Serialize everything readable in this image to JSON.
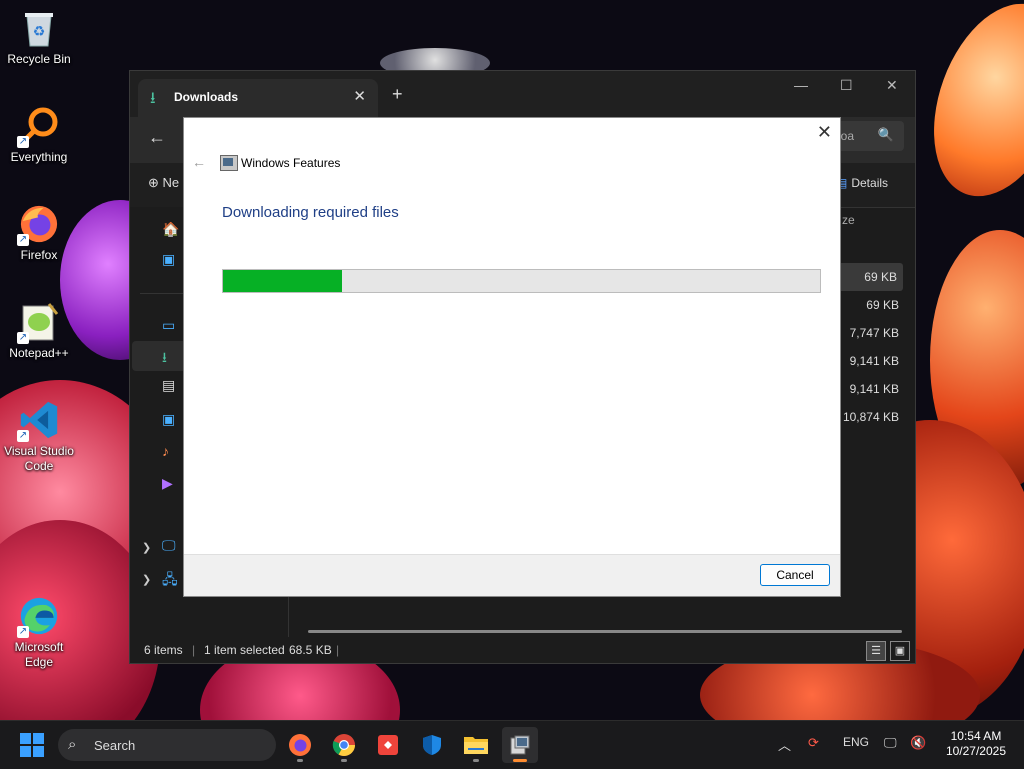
{
  "desktop": {
    "icons": [
      {
        "label": "Recycle Bin",
        "icon": "recycle-bin-icon"
      },
      {
        "label": "Everything",
        "icon": "everything-icon"
      },
      {
        "label": "Firefox",
        "icon": "firefox-icon"
      },
      {
        "label": "Notepad++",
        "icon": "notepad-plus-plus-icon"
      },
      {
        "label": "Visual Studio Code",
        "icon": "vscode-icon"
      },
      {
        "label": "Microsoft Edge",
        "icon": "edge-icon"
      }
    ]
  },
  "explorer": {
    "tab_title": "Downloads",
    "search_text": "loa",
    "new_label": "Ne",
    "details_label": "Details",
    "size_column": "ze",
    "sizes": [
      "69 KB",
      "69 KB",
      "7,747 KB",
      "9,141 KB",
      "9,141 KB",
      "10,874 KB"
    ],
    "status": {
      "items": "6 items",
      "selected": "1 item selected",
      "selected_size": "68.5 KB"
    }
  },
  "dialog": {
    "title": "Windows Features",
    "heading": "Downloading required files",
    "progress": 0.2,
    "cancel_label": "Cancel"
  },
  "taskbar": {
    "search_label": "Search",
    "apps": [
      "firefox-icon",
      "chrome-icon",
      "anydesk-icon",
      "defender-icon",
      "file-explorer-icon",
      "windows-features-icon"
    ],
    "language": "ENG",
    "time": "10:54 AM",
    "date": "10/27/2025"
  }
}
